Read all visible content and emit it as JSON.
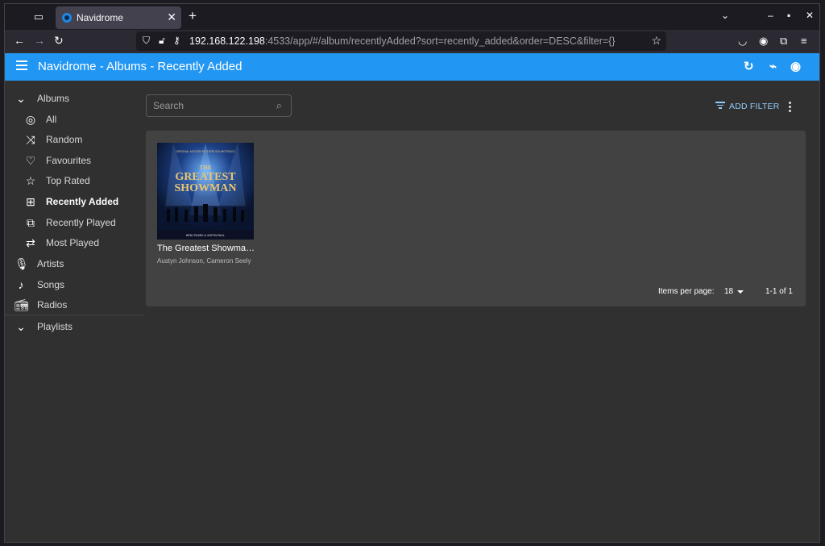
{
  "browser": {
    "tab_title": "Navidrome",
    "url_host": "192.168.122.198",
    "url_rest": ":4533/app/#/album/recentlyAdded?sort=recently_added&order=DESC&filter={}"
  },
  "appbar": {
    "title": "Navidrome - Albums - Recently Added"
  },
  "sidebar": {
    "albums_label": "Albums",
    "items": [
      {
        "label": "All",
        "icon": "disc-icon"
      },
      {
        "label": "Random",
        "icon": "shuffle-icon"
      },
      {
        "label": "Favourites",
        "icon": "heart-icon"
      },
      {
        "label": "Top Rated",
        "icon": "star-icon"
      },
      {
        "label": "Recently Added",
        "icon": "library-add-icon",
        "active": true
      },
      {
        "label": "Recently Played",
        "icon": "video-library-icon"
      },
      {
        "label": "Most Played",
        "icon": "repeat-icon"
      }
    ],
    "artists_label": "Artists",
    "songs_label": "Songs",
    "radios_label": "Radios",
    "playlists_label": "Playlists"
  },
  "toolbar": {
    "search_placeholder": "Search",
    "add_filter": "ADD FILTER"
  },
  "albums": [
    {
      "title": "The Greatest Showma…",
      "artist": "Austyn Johnson, Cameron Seely",
      "cover_top_text": "ORIGINAL MOTION PICTURE SOUNDTRACK",
      "cover_title_1": "THE",
      "cover_title_2": "GREATEST",
      "cover_title_3": "SHOWMAN",
      "cover_bottom_text": "BENJ PASEK & JUSTIN PAUL"
    }
  ],
  "pagination": {
    "label": "Items per page:",
    "per_page": "18",
    "range": "1-1 of 1"
  },
  "colors": {
    "appbar": "#2196f3",
    "background": "#303030",
    "card": "#424242"
  }
}
